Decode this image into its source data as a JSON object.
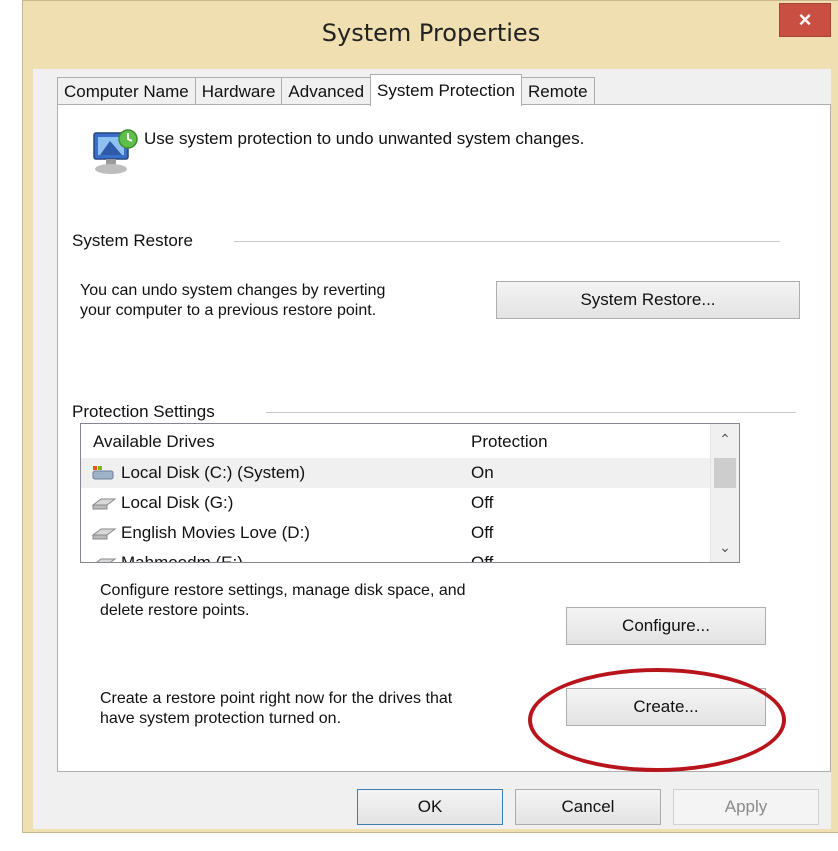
{
  "window": {
    "title": "System Properties",
    "close_symbol": "×"
  },
  "tabs": [
    {
      "label": "Computer Name"
    },
    {
      "label": "Hardware"
    },
    {
      "label": "Advanced"
    },
    {
      "label": "System Protection",
      "active": true
    },
    {
      "label": "Remote"
    }
  ],
  "intro": {
    "text": "Use system protection to undo unwanted system changes.",
    "icon": "system-protection-icon"
  },
  "system_restore": {
    "group_label": "System Restore",
    "description_line1": "You can undo system changes by reverting",
    "description_line2": "your computer to a previous restore point.",
    "button_label": "System Restore..."
  },
  "protection_settings": {
    "group_label": "Protection Settings",
    "columns": {
      "drive": "Available Drives",
      "protection": "Protection"
    },
    "drives": [
      {
        "name": "Local Disk (C:) (System)",
        "protection": "On",
        "icon": "system-drive-icon"
      },
      {
        "name": "Local Disk (G:)",
        "protection": "Off",
        "icon": "drive-icon"
      },
      {
        "name": "English Movies Love (D:)",
        "protection": "Off",
        "icon": "drive-icon"
      },
      {
        "name": "Mahmoodm (E:)",
        "protection": "Off",
        "icon": "drive-icon"
      }
    ],
    "configure_desc_line1": "Configure restore settings, manage disk space, and",
    "configure_desc_line2": "delete restore points.",
    "configure_button": "Configure...",
    "create_desc_line1": "Create a restore point right now for the drives that",
    "create_desc_line2": "have system protection turned on.",
    "create_button": "Create..."
  },
  "footer": {
    "ok": "OK",
    "cancel": "Cancel",
    "apply": "Apply"
  },
  "colors": {
    "title_bar": "#f0dfb1",
    "close_button": "#c84f42",
    "annotation": "#b8141c"
  }
}
